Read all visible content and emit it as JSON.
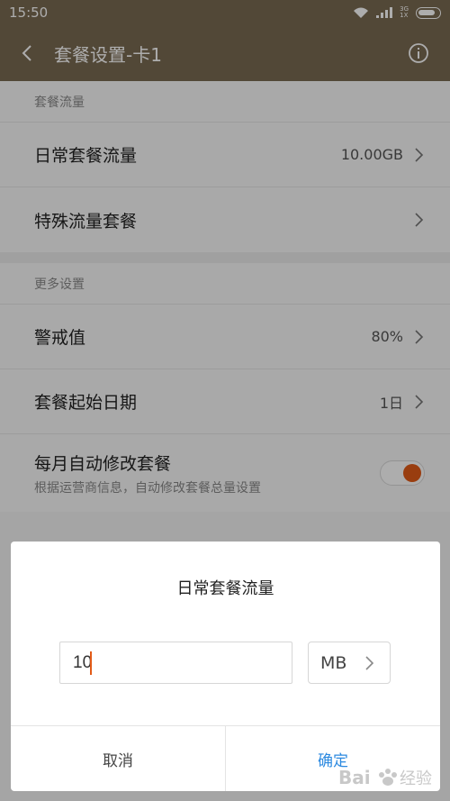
{
  "status_bar": {
    "time": "15:50",
    "network_top": "3G",
    "network_bottom": "1X"
  },
  "app_bar": {
    "title": "套餐设置-卡1",
    "back_icon": "chevron-left-icon",
    "info_icon": "info-circle-icon"
  },
  "sections": [
    {
      "header": "套餐流量",
      "items": [
        {
          "label": "日常套餐流量",
          "value": "10.00GB"
        },
        {
          "label": "特殊流量套餐",
          "value": ""
        }
      ]
    },
    {
      "header": "更多设置",
      "items": [
        {
          "label": "警戒值",
          "value": "80%"
        },
        {
          "label": "套餐起始日期",
          "value": "1日"
        }
      ],
      "toggle": {
        "label": "每月自动修改套餐",
        "sublabel": "根据运营商信息，自动修改套餐总量设置",
        "on": true
      }
    }
  ],
  "dialog": {
    "title": "日常套餐流量",
    "input_value": "10",
    "unit": "MB",
    "cancel_label": "取消",
    "confirm_label": "确定"
  },
  "colors": {
    "app_bar": "#7a6a52",
    "accent": "#e25a17",
    "confirm": "#2d8ae0",
    "overlay": "rgba(0,0,0,0.32)"
  }
}
